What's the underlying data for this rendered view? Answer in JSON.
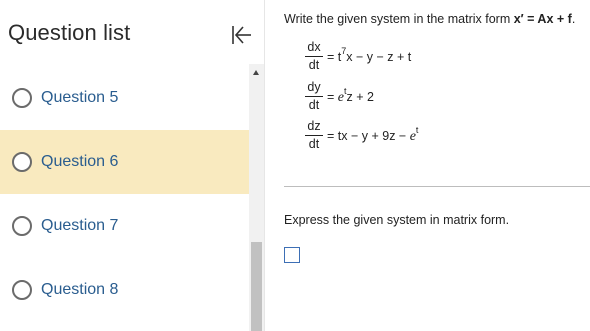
{
  "sidebar": {
    "title": "Question list",
    "questions": [
      {
        "label": "Question 5",
        "selected": false
      },
      {
        "label": "Question 6",
        "selected": true
      },
      {
        "label": "Question 7",
        "selected": false
      },
      {
        "label": "Question 8",
        "selected": false
      }
    ]
  },
  "main": {
    "prompt_pre": "Write the given system in the matrix form ",
    "prompt_bold": "x′ = Ax + f",
    "prompt_post": ".",
    "equations": [
      {
        "num": "dx",
        "den": "dt",
        "rhs_html": "= t<sup>7</sup>x − y − z + t"
      },
      {
        "num": "dy",
        "den": "dt",
        "rhs_html": "= <i>e</i><sup>t</sup>z + 2"
      },
      {
        "num": "dz",
        "den": "dt",
        "rhs_html": "= tx − y + 9z − <i>e</i><sup>t</sup>"
      }
    ],
    "instruction": "Express the given system in matrix form."
  },
  "colors": {
    "selected_bg": "#f9eabf",
    "link_text": "#2a5d8f",
    "answer_box_border": "#3d6fb5"
  },
  "icons": {
    "collapse": "collapse-left-icon"
  }
}
